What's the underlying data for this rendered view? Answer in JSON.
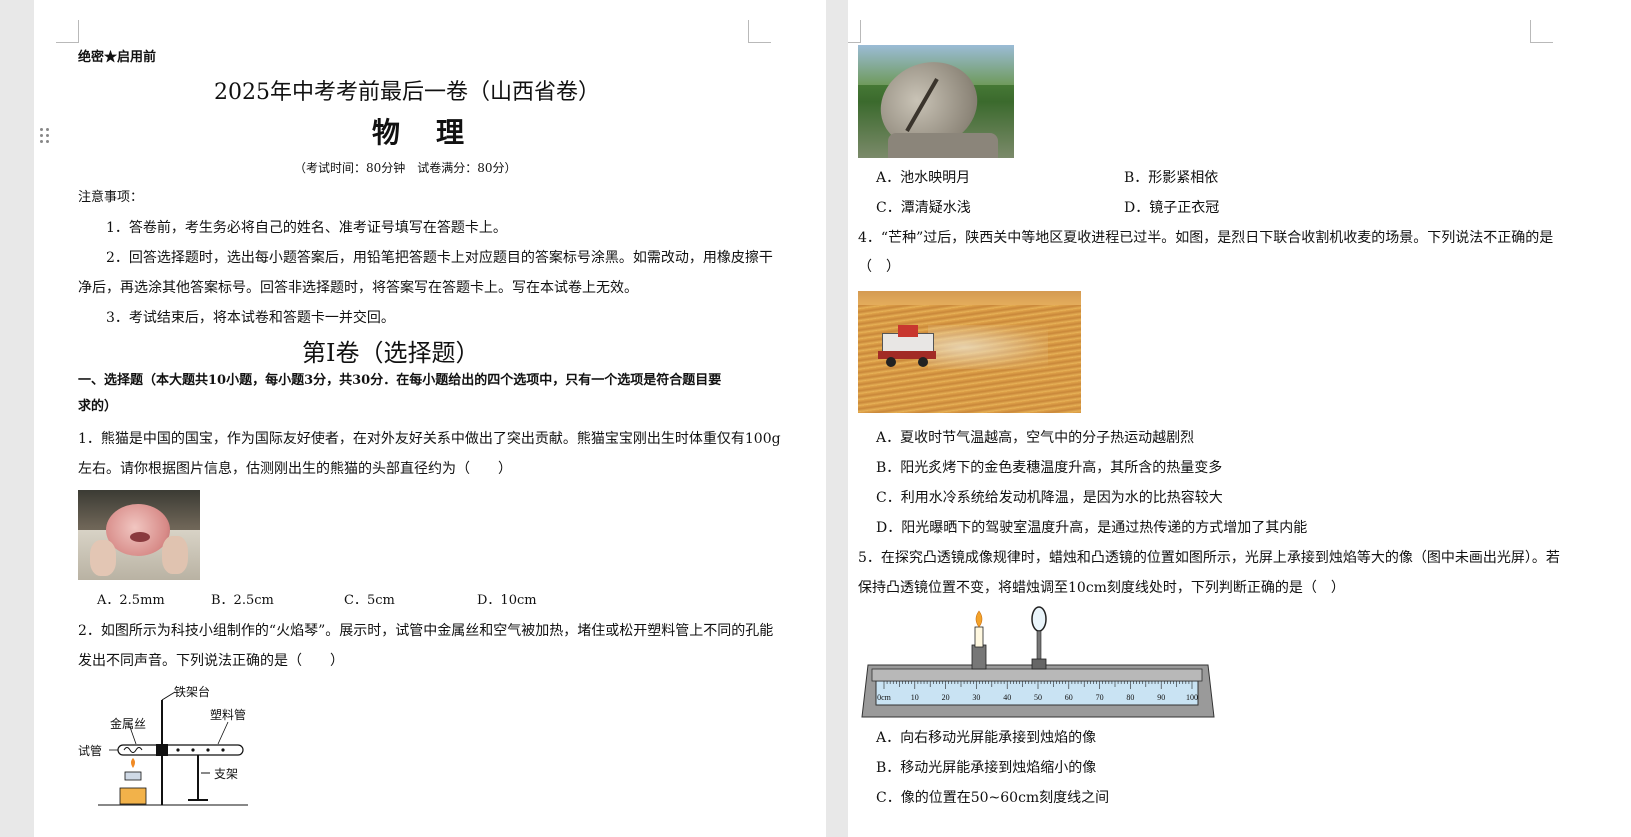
{
  "left_page": {
    "secret_label": "绝密★启用前",
    "title": "2025年中考考前最后一卷（山西省卷）",
    "subject": "物　理",
    "exam_info": "（考试时间：80分钟　试卷满分：80分）",
    "notice_heading": "注意事项：",
    "notices": [
      "1．答卷前，考生务必将自己的姓名、准考证号填写在答题卡上。",
      "2．回答选择题时，选出每小题答案后，用铅笔把答题卡上对应题目的答案标号涂黑。如需改动，用橡皮擦干",
      "净后，再选涂其他答案标号。回答非选择题时，将答案写在答题卡上。写在本试卷上无效。",
      "3．考试结束后，将本试卷和答题卡一并交回。"
    ],
    "volume_title": "第Ⅰ卷（选择题）",
    "section_heading_line1": "一、选择题（本大题共10小题，每小题3分，共30分．在每小题给出的四个选项中，只有一个选项是符合题目要",
    "section_heading_line2": "求的）",
    "q1": {
      "line1": "1．熊猫是中国的国宝，作为国际友好使者，在对外友好关系中做出了突出贡献。熊猫宝宝刚出生时体重仅有100g",
      "line2": "左右。请你根据图片信息，估测刚出生的熊猫的头部直径约为（　　）",
      "options": [
        "A．2.5mm",
        "B．2.5cm",
        "C．5cm",
        "D．10cm"
      ]
    },
    "q2": {
      "line1": "2．如图所示为科技小组制作的“火焰琴”。展示时，试管中金属丝和空气被加热，堵住或松开塑料管上不同的孔能",
      "line2": "发出不同声音。下列说法正确的是（　　）",
      "figure_labels": {
        "stand": "铁架台",
        "wire": "金属丝",
        "plastic_tube": "塑料管",
        "test_tube": "试管",
        "support": "支架"
      }
    }
  },
  "right_page": {
    "q3_options": [
      "A．池水映明月",
      "B．形影紧相依",
      "C．潭清疑水浅",
      "D．镜子正衣冠"
    ],
    "q4": {
      "line1": "4．“芒种”过后，陕西关中等地区夏收进程已过半。如图，是烈日下联合收割机收麦的场景。下列说法不正确的是",
      "line2": "（　）",
      "options": [
        "A．夏收时节气温越高，空气中的分子热运动越剧烈",
        "B．阳光炙烤下的金色麦穗温度升高，其所含的热量变多",
        "C．利用水冷系统给发动机降温，是因为水的比热容较大",
        "D．阳光曝晒下的驾驶室温度升高，是通过热传递的方式增加了其内能"
      ]
    },
    "q5": {
      "line1": "5．在探究凸透镜成像规律时，蜡烛和凸透镜的位置如图所示，光屏上承接到烛焰等大的像（图中未画出光屏）。若",
      "line2": "保持凸透镜位置不变，将蜡烛调至10cm刻度线处时，下列判断正确的是（　）",
      "ruler_labels": [
        "0cm",
        "10",
        "20",
        "30",
        "40",
        "50",
        "60",
        "70",
        "80",
        "90",
        "100"
      ],
      "options": [
        "A．向右移动光屏能承接到烛焰的像",
        "B．移动光屏能承接到烛焰缩小的像",
        "C．像的位置在50~60cm刻度线之间"
      ]
    }
  }
}
